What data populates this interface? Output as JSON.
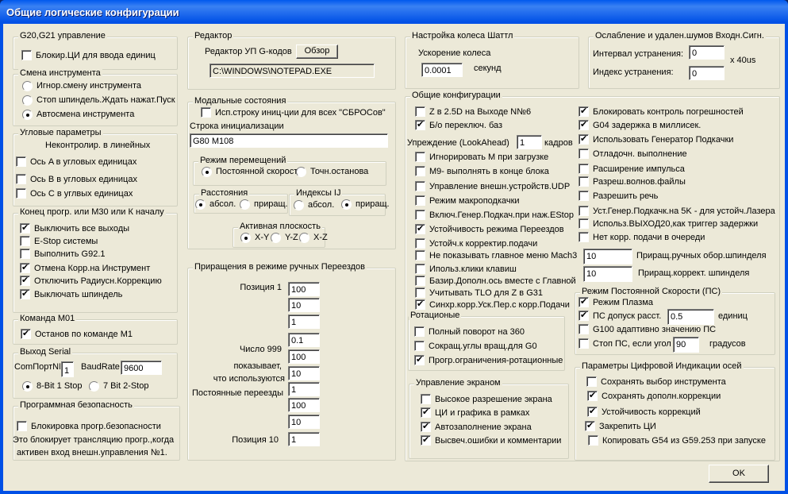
{
  "window": {
    "title": "Общие логические конфигурации"
  },
  "g20": {
    "title": "G20,G21 управление",
    "items": [
      {
        "label": "Блокир.ЦИ для ввода единиц",
        "checked": false
      }
    ]
  },
  "tool": {
    "title": "Смена инструмента",
    "options": [
      {
        "label": "Игнор.смену инструмента",
        "selected": false
      },
      {
        "label": "Стоп шпиндель.Ждать нажат.Пуск",
        "selected": false
      },
      {
        "label": "Автосмена инструмента",
        "selected": true
      }
    ]
  },
  "angular": {
    "title": "Угловые параметры",
    "note": "Неконтролир. в линейных",
    "items": [
      {
        "label": "Ось A в угловых единицах",
        "checked": false
      },
      {
        "label": "Ось B в угловых единицах",
        "checked": false
      },
      {
        "label": "Ось C в углвых единицах",
        "checked": false
      }
    ]
  },
  "end": {
    "title": "Конец прогр. или M30 или К началу",
    "items": [
      {
        "label": "Выключить все выходы",
        "checked": true
      },
      {
        "label": "E-Stop системы",
        "checked": false
      },
      {
        "label": "Выполнить G92.1",
        "checked": false
      },
      {
        "label": "Отмена Корр.на Инструмент",
        "checked": true
      },
      {
        "label": "Отключить Радиусн.Коррекцию",
        "checked": true
      },
      {
        "label": "Выключать шпиндель",
        "checked": true
      }
    ]
  },
  "m01": {
    "title": "Команда M01",
    "items": [
      {
        "label": "Останов по команде M1",
        "checked": true
      }
    ]
  },
  "serial": {
    "title": "Выход Serial",
    "port_label": "ComПортN№",
    "port": "1",
    "baud_label": "BaudRate",
    "baud": "9600",
    "options": [
      {
        "label": "8-Bit 1 Stop",
        "selected": true
      },
      {
        "label": "7 Bit 2-Stop",
        "selected": false
      }
    ]
  },
  "security": {
    "title": "Программная безопасность",
    "items": [
      {
        "label": "Блокировка прогр.безопасности",
        "checked": false
      }
    ],
    "note1": "Это блокирует трансляцию прогр.,когда",
    "note2": "активен вход внешн.управления №1."
  },
  "editor": {
    "title": "Редактор",
    "label": "Редактор УП G-кодов",
    "browse": "Обзор",
    "path": "C:\\WINDOWS\\NOTEPAD.EXE"
  },
  "modal": {
    "title": "Модальные состояния",
    "items": [
      {
        "label": "Исп.строку иниц-ции для всех \"СБРОСов\"",
        "checked": false
      }
    ],
    "init_label": "Строка инициализации",
    "init": "G80 M108",
    "motion": {
      "title": "Режим перемещений",
      "options": [
        {
          "label": "Постоянной скорости",
          "selected": true
        },
        {
          "label": "Точн.останова",
          "selected": false
        }
      ]
    },
    "distance": {
      "title": "Расстояния",
      "options": [
        {
          "label": "абсол.",
          "selected": true
        },
        {
          "label": "приращ.",
          "selected": false
        }
      ]
    },
    "ij": {
      "title": "Индексы IJ",
      "options": [
        {
          "label": "абсол.",
          "selected": false
        },
        {
          "label": "приращ.",
          "selected": true
        }
      ]
    },
    "plane": {
      "title": "Активная плоскость",
      "options": [
        {
          "label": "X-Y",
          "selected": true
        },
        {
          "label": "Y-Z",
          "selected": false
        },
        {
          "label": "X-Z",
          "selected": false
        }
      ]
    }
  },
  "jog": {
    "title": "Приращения в режиме ручных Переездов",
    "pos1": "Позиция 1",
    "pos10": "Позиция 10",
    "note": [
      "Число 999",
      "показывает,",
      "что используются",
      "Постоянные переезды"
    ],
    "values": [
      "100",
      "10",
      "1",
      "0.1",
      "100",
      "10",
      "1",
      "100",
      "10",
      "1"
    ]
  },
  "shuttle": {
    "title": "Настройка колеса Шаттл",
    "label": "Ускорение колеса",
    "value": "0.0001",
    "unit": "секунд"
  },
  "debounce": {
    "title": "Ослабление и удален.шумов Входн.Сигн.",
    "interval_label": "Интервал устранения:",
    "interval": "0",
    "index_label": "Индекс устранения:",
    "index": "0",
    "unit": "x 40us"
  },
  "general": {
    "title": "Общие конфигурации",
    "lookahead_label": "Упреждение (LookAhead)",
    "lookahead": "1",
    "lookahead_unit": "кадров",
    "left": [
      {
        "label": "Z в 2.5D на Выходе N№6",
        "checked": false
      },
      {
        "label": "Б/о переключ. баз",
        "checked": true
      },
      {
        "label": "Игнорировать M при загрузке",
        "checked": false
      },
      {
        "label": "M9- выполнять в конце блока",
        "checked": false
      },
      {
        "label": "Управление внешн.устройств.UDP",
        "checked": false
      },
      {
        "label": "Режим макроподкачки",
        "checked": false
      },
      {
        "label": "Включ.Генер.Подкач.при наж.EStop",
        "checked": false
      },
      {
        "label": "Устойчивость режима Переездов",
        "checked": true
      },
      {
        "label": "Устойч.к корректир.подачи",
        "checked": false
      },
      {
        "label": "Не показывать главное меню Mach3",
        "checked": false
      },
      {
        "label": "Ипольз.клики клавиш",
        "checked": false
      },
      {
        "label": "Базир.Дополн.ось вместе с Главной",
        "checked": false
      },
      {
        "label": "Учитывать TLO для Z в G31",
        "checked": false
      },
      {
        "label": "Синхр.корр.Уск.Пер.с корр.Подачи",
        "checked": true
      }
    ],
    "right": [
      {
        "label": "Блокировать контроль погрешностей",
        "checked": true
      },
      {
        "label": "G04 задержка в миллисек.",
        "checked": true
      },
      {
        "label": "Использовать Генератор Подкачки",
        "checked": true
      },
      {
        "label": "Отладочн. выполнение",
        "checked": false
      },
      {
        "label": "Расширение импульса",
        "checked": false
      },
      {
        "label": "Разреш.волнов.файлы",
        "checked": false
      },
      {
        "label": "Разрешить речь",
        "checked": false
      },
      {
        "label": "Уст.Генер.Подкачк.на 5K - для устойч.Лазера",
        "checked": false
      },
      {
        "label": "Использ.ВЫХОД20,как триггер задержки",
        "checked": false
      },
      {
        "label": "Нет корр. подачи в очереди",
        "checked": false
      }
    ],
    "spindle_jog": "10",
    "spindle_jog_label": "Приращ.ручных обор.шпинделя",
    "spindle_ovr": "10",
    "spindle_ovr_label": "Приращ.коррект. шпинделя"
  },
  "rotary": {
    "title": "Ротационые",
    "items": [
      {
        "label": "Полный поворот на 360",
        "checked": false
      },
      {
        "label": "Сокращ.углы вращ.для G0",
        "checked": false
      },
      {
        "label": "Прогр.ограничения-ротационные",
        "checked": true
      }
    ]
  },
  "screen": {
    "title": "Управление экраном",
    "items": [
      {
        "label": "Высокое разрешение экрана",
        "checked": false
      },
      {
        "label": "ЦИ и графика в рамках",
        "checked": true
      },
      {
        "label": "Автозаполнение экрана",
        "checked": true
      },
      {
        "label": "Высвеч.ошибки и комментарии",
        "checked": true
      }
    ]
  },
  "cv": {
    "title": "Режим Постоянной Скорости (ПС)",
    "items": [
      {
        "label": "Режим Плазма",
        "checked": true
      },
      {
        "label": "ПС допуск расст.",
        "checked": true
      },
      {
        "label": "G100 адаптивно значению ПС",
        "checked": false
      },
      {
        "label": "Стоп ПС, если угол >",
        "checked": false
      }
    ],
    "tol": "0.5",
    "tol_unit": "единиц",
    "angle": "90",
    "angle_unit": "градусов"
  },
  "dro": {
    "title": "Параметры Цифровой Индикации осей",
    "items": [
      {
        "label": "Сохранять выбор инструмента",
        "checked": false
      },
      {
        "label": "Сохранять дополн.коррекции",
        "checked": true
      },
      {
        "label": "Устойчивость коррекций",
        "checked": true
      },
      {
        "label": "Закрепить ЦИ",
        "checked": true
      },
      {
        "label": "Копировать G54 из G59.253 при запуске",
        "checked": false
      }
    ]
  },
  "ok": "OK"
}
